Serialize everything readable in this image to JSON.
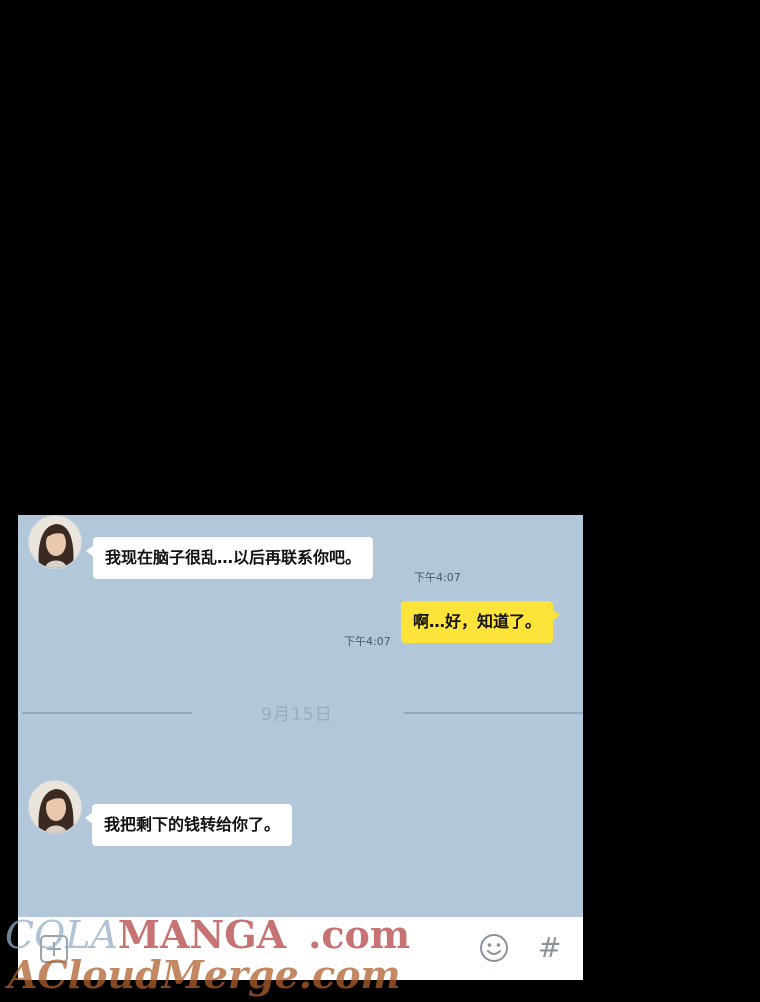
{
  "chat": {
    "messages": [
      {
        "sender": "other",
        "text": "我现在脑子很乱…以后再联系你吧。",
        "time": "下午4:07"
      },
      {
        "sender": "me",
        "text": "啊…好，知道了。",
        "time": "下午4:07"
      },
      {
        "sender": "other",
        "text": "我把剩下的钱转给你了。",
        "time": ""
      }
    ],
    "date_divider": "9月15日"
  },
  "input_bar": {
    "icons": [
      "plus-icon",
      "emoji-icon",
      "hash-icon"
    ],
    "hash_glyph": "#"
  },
  "watermark": {
    "line1_part1": "COLA",
    "line1_part2": "MANGA",
    "line1_part3": ".com",
    "line2": "ACloudMerge.com"
  },
  "colors": {
    "chat_background": "#b2c7da",
    "my_bubble": "#fee33a",
    "other_bubble": "#ffffff"
  }
}
